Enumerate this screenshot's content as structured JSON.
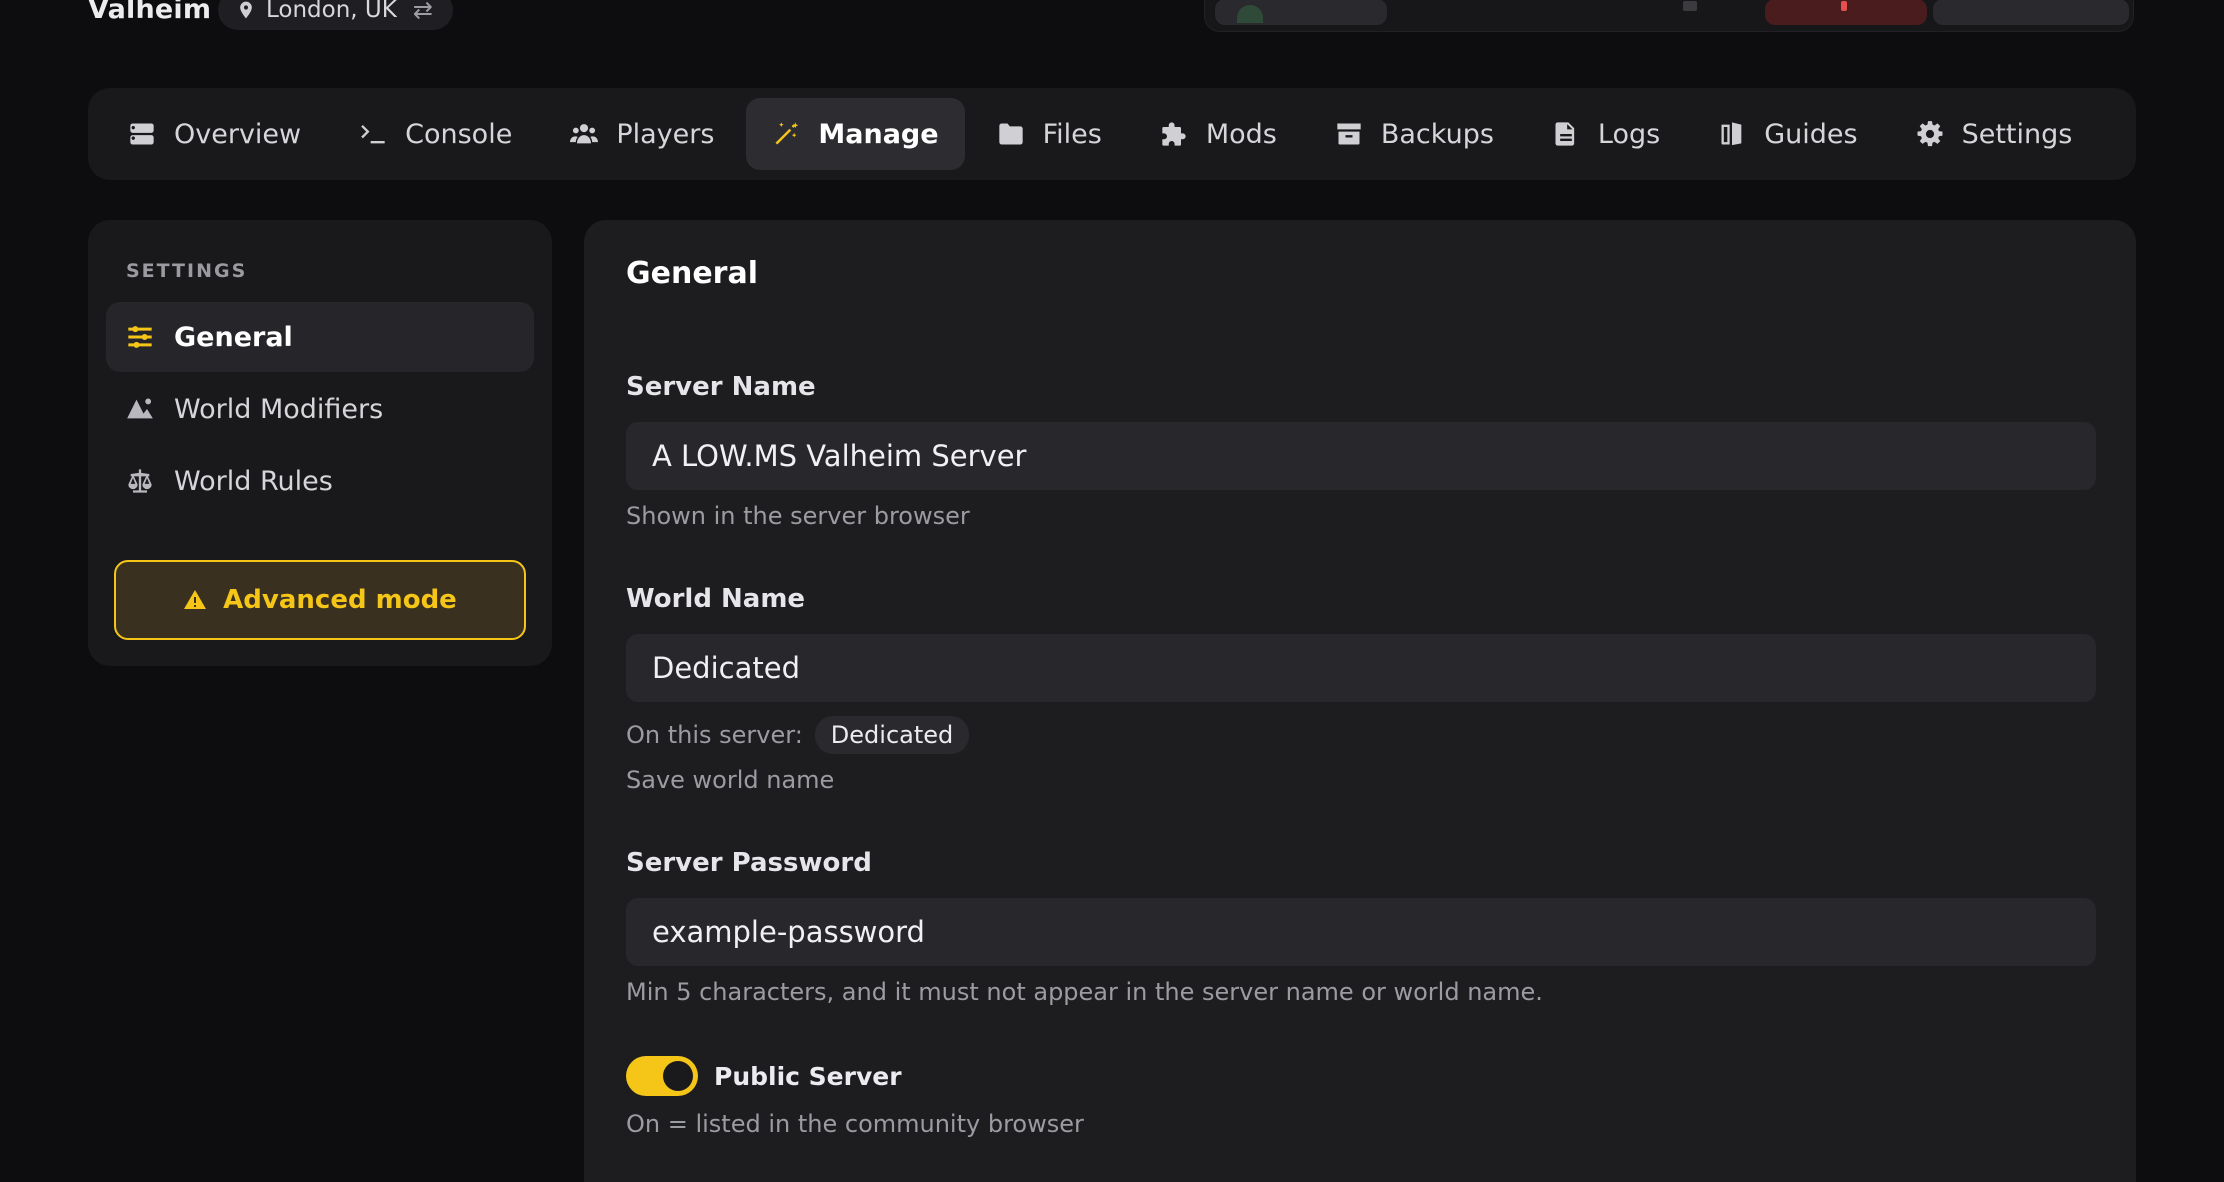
{
  "header": {
    "server_name": "Valheim",
    "location": "London, UK",
    "swap_glyph": "⇄"
  },
  "tabs": [
    {
      "label": "Overview",
      "icon": "server-icon"
    },
    {
      "label": "Console",
      "icon": "terminal-icon"
    },
    {
      "label": "Players",
      "icon": "users-icon"
    },
    {
      "label": "Manage",
      "icon": "magic-wand-icon",
      "active": true
    },
    {
      "label": "Files",
      "icon": "folder-icon"
    },
    {
      "label": "Mods",
      "icon": "puzzle-icon"
    },
    {
      "label": "Backups",
      "icon": "archive-icon"
    },
    {
      "label": "Logs",
      "icon": "file-icon"
    },
    {
      "label": "Guides",
      "icon": "book-icon"
    },
    {
      "label": "Settings",
      "icon": "gear-icon"
    }
  ],
  "sidebar": {
    "heading": "SETTINGS",
    "items": [
      {
        "label": "General",
        "icon": "sliders-icon",
        "active": true
      },
      {
        "label": "World Modifiers",
        "icon": "mountain-icon"
      },
      {
        "label": "World Rules",
        "icon": "scale-icon"
      }
    ],
    "advanced_label": "Advanced mode"
  },
  "main": {
    "title": "General",
    "server_name": {
      "label": "Server Name",
      "value": "A LOW.MS Valheim Server",
      "hint": "Shown in the server browser"
    },
    "world_name": {
      "label": "World Name",
      "value": "Dedicated",
      "on_server_label": "On this server:",
      "on_server_value": "Dedicated",
      "save_label": "Save world name"
    },
    "server_password": {
      "label": "Server Password",
      "value": "example-password",
      "hint": "Min 5 characters, and it must not appear in the server name or world name."
    },
    "public_server": {
      "label": "Public Server",
      "on": true,
      "hint": "On = listed in the community browser"
    }
  },
  "colors": {
    "accent": "#f5c518",
    "background": "#0d0d0f",
    "panel": "#1d1d20"
  }
}
